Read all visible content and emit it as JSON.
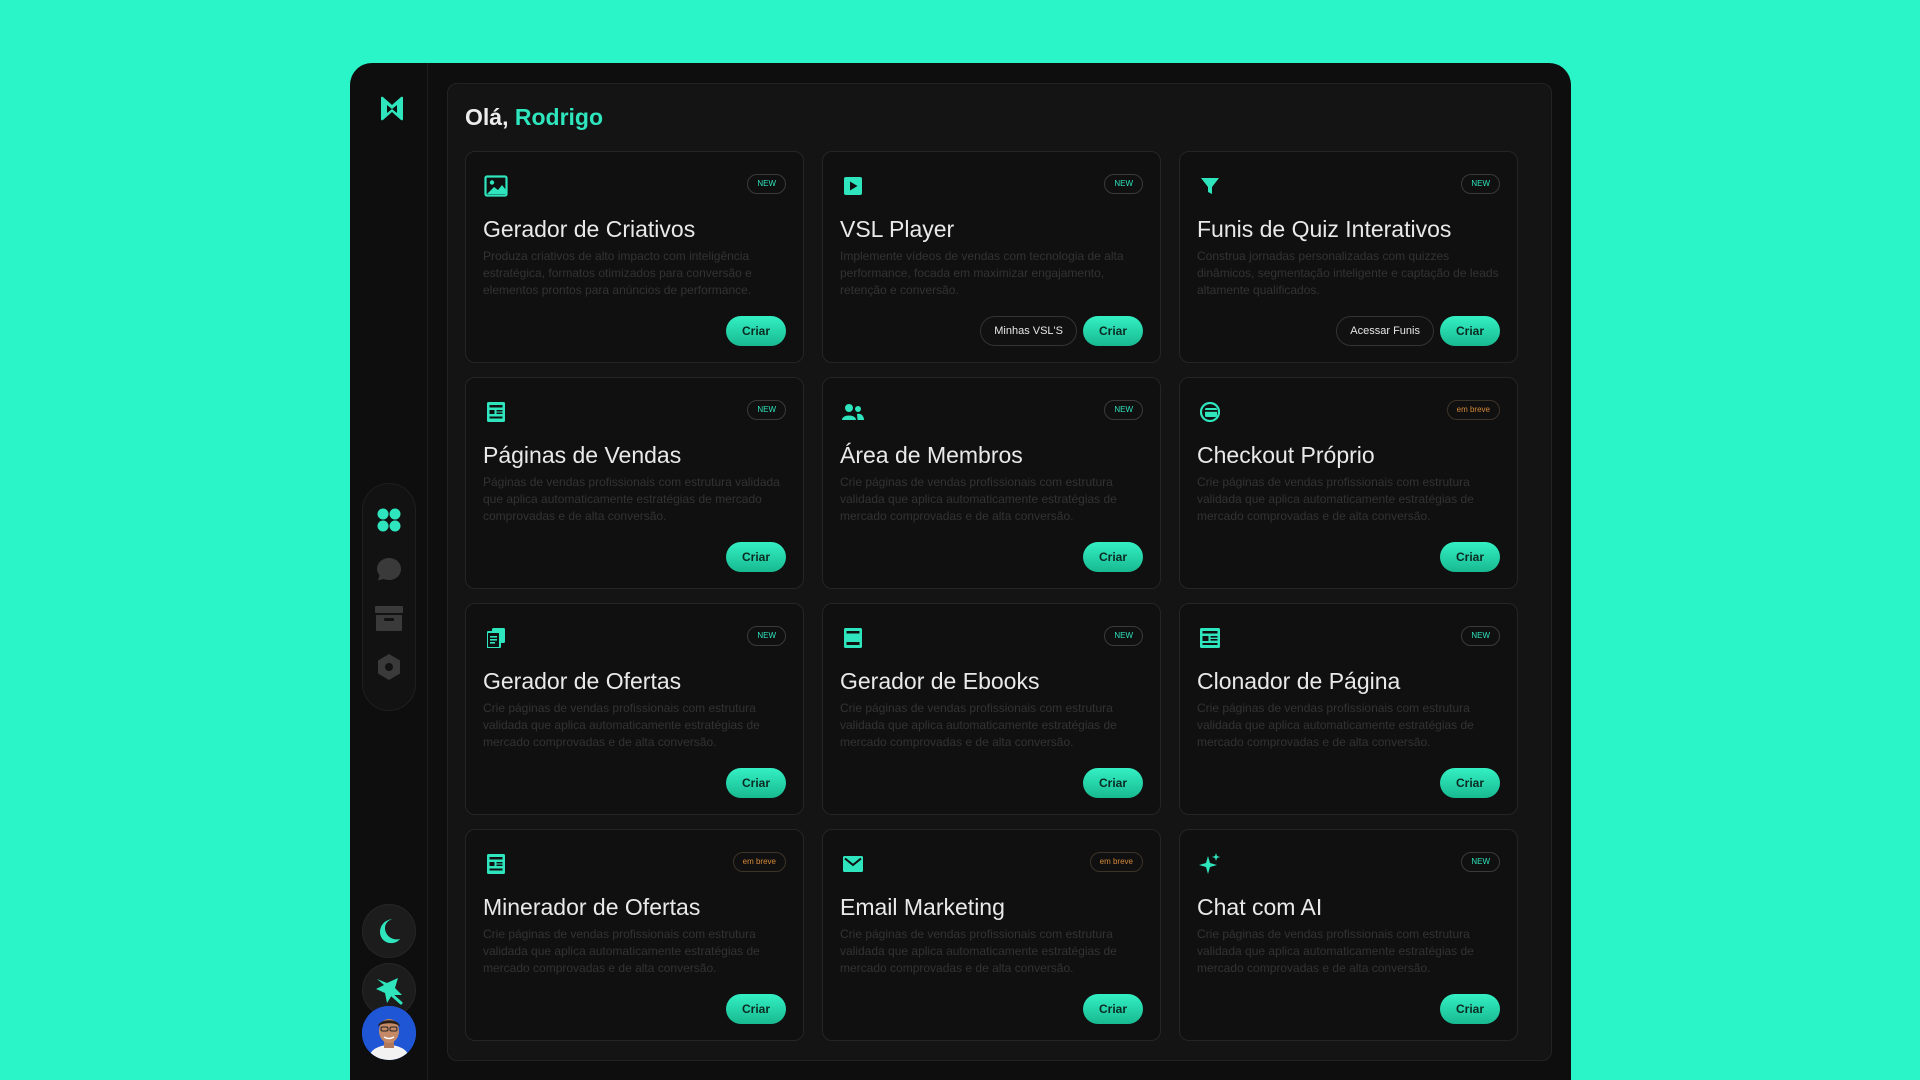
{
  "greeting": {
    "prefix": "Olá,",
    "name": "Rodrigo"
  },
  "sidebar": {
    "logo_icon": "n-logo-icon",
    "nav": [
      {
        "icon": "grid-icon",
        "active": true
      },
      {
        "icon": "chat-icon",
        "active": false
      },
      {
        "icon": "archive-icon",
        "active": false
      },
      {
        "icon": "settings-icon",
        "active": false
      }
    ],
    "theme_icon": "moon-icon",
    "pin_icon": "star-badge-icon",
    "avatar": "user-avatar"
  },
  "colors": {
    "background": "#2af5c8",
    "accent": "#2ee5bd",
    "window": "#0e0e0e",
    "soon": "#d58a3a"
  },
  "cards": [
    {
      "icon": "image-icon",
      "badge": "NEW",
      "badge_type": "new",
      "title": "Gerador de Criativos",
      "desc": "Produza criativos de alto impacto com inteligência estratégica, formatos otimizados para conversão e elementos prontos para anúncios de performance.",
      "secondary": "",
      "create": "Criar"
    },
    {
      "icon": "play-icon",
      "badge": "NEW",
      "badge_type": "new",
      "title": "VSL Player",
      "desc": "Implemente vídeos de vendas com tecnologia de alta performance, focada em maximizar engajamento, retenção e conversão.",
      "secondary": "Minhas VSL'S",
      "create": "Criar"
    },
    {
      "icon": "funnel-icon",
      "badge": "NEW",
      "badge_type": "new",
      "title": "Funis de Quiz Interativos",
      "desc": "Construa jornadas personalizadas com quizzes dinâmicos, segmentação inteligente e captação de leads altamente qualificados.",
      "secondary": "Acessar Funis",
      "create": "Criar"
    },
    {
      "icon": "page-icon",
      "badge": "NEW",
      "badge_type": "new",
      "title": "Páginas de Vendas",
      "desc": "Páginas de vendas profissionais com estrutura validada que aplica automaticamente estratégias de mercado comprovadas e de alta conversão.",
      "secondary": "",
      "create": "Criar"
    },
    {
      "icon": "members-icon",
      "badge": "NEW",
      "badge_type": "new",
      "title": "Área de Membros",
      "desc": "Crie páginas de vendas profissionais com estrutura validada que aplica automaticamente estratégias de mercado comprovadas e de alta conversão.",
      "secondary": "",
      "create": "Criar"
    },
    {
      "icon": "credit-card-icon",
      "badge": "em breve",
      "badge_type": "soon",
      "title": "Checkout Próprio",
      "desc": "Crie páginas de vendas profissionais com estrutura validada que aplica automaticamente estratégias de mercado comprovadas e de alta conversão.",
      "secondary": "",
      "create": "Criar"
    },
    {
      "icon": "documents-icon",
      "badge": "NEW",
      "badge_type": "new",
      "title": "Gerador de Ofertas",
      "desc": "Crie páginas de vendas profissionais com estrutura validada que aplica automaticamente estratégias de mercado comprovadas e de alta conversão.",
      "secondary": "",
      "create": "Criar"
    },
    {
      "icon": "book-icon",
      "badge": "NEW",
      "badge_type": "new",
      "title": "Gerador de Ebooks",
      "desc": "Crie páginas de vendas profissionais com estrutura validada que aplica automaticamente estratégias de mercado comprovadas e de alta conversão.",
      "secondary": "",
      "create": "Criar"
    },
    {
      "icon": "clone-page-icon",
      "badge": "NEW",
      "badge_type": "new",
      "title": "Clonador de Página",
      "desc": "Crie páginas de vendas profissionais com estrutura validada que aplica automaticamente estratégias de mercado comprovadas e de alta conversão.",
      "secondary": "",
      "create": "Criar"
    },
    {
      "icon": "page-icon",
      "badge": "em breve",
      "badge_type": "soon",
      "title": "Minerador de Ofertas",
      "desc": "Crie páginas de vendas profissionais com estrutura validada que aplica automaticamente estratégias de mercado comprovadas e de alta conversão.",
      "secondary": "",
      "create": "Criar"
    },
    {
      "icon": "mail-icon",
      "badge": "em breve",
      "badge_type": "soon",
      "title": "Email Marketing",
      "desc": "Crie páginas de vendas profissionais com estrutura validada que aplica automaticamente estratégias de mercado comprovadas e de alta conversão.",
      "secondary": "",
      "create": "Criar"
    },
    {
      "icon": "sparkles-icon",
      "badge": "NEW",
      "badge_type": "new",
      "title": "Chat com AI",
      "desc": "Crie páginas de vendas profissionais com estrutura validada que aplica automaticamente estratégias de mercado comprovadas e de alta conversão.",
      "secondary": "",
      "create": "Criar"
    }
  ]
}
